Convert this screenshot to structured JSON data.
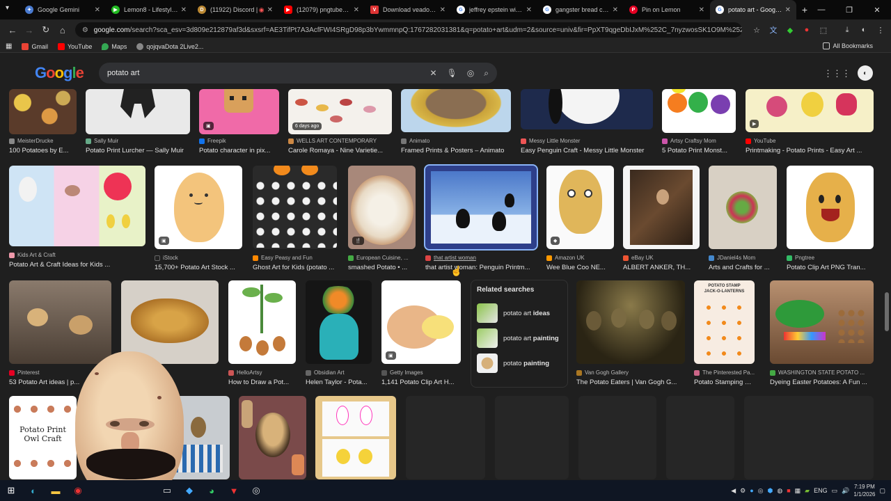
{
  "browser": {
    "tabs": [
      {
        "label": "Google Gemini",
        "color": "#4a7bd0",
        "glyph": "✦"
      },
      {
        "label": "Lemon8 - Lifestyle Co",
        "color": "#e8d34a",
        "glyph": "▶"
      },
      {
        "label": "(11922) Discord |",
        "color": "#5865f2",
        "glyph": "D"
      },
      {
        "label": "(12079) pngtuber - Y",
        "color": "#ff0000",
        "glyph": "▶"
      },
      {
        "label": "Download veadotube",
        "color": "#d33",
        "glyph": "V"
      },
      {
        "label": "jeffrey epstein witho",
        "color": "#4285f4",
        "glyph": "G"
      },
      {
        "label": "gangster bread carto",
        "color": "#4285f4",
        "glyph": "G"
      },
      {
        "label": "Pin on Lemon",
        "color": "#e60023",
        "glyph": "P"
      },
      {
        "label": "potato art - Google S",
        "color": "#4285f4",
        "glyph": "G"
      }
    ],
    "url_domain": "google.com",
    "url_rest": "/search?sca_esv=3d809e212879af3d&sxsrf=AE3TifPt7A3AcfFWI4SRgD98p3bYwmmnpQ:1767282031381&q=potato+art&udm=2&source=univ&fir=PpXT9qgeDbIJxM%252C_7nyzwosSK1O9M%252C_%2538GEkb1..."
  },
  "bookmarks": [
    {
      "label": "Gmail",
      "color": "#ea4335"
    },
    {
      "label": "YouTube",
      "color": "#ff0000"
    },
    {
      "label": "Maps",
      "color": "#34a853"
    },
    {
      "label": "qojqvaDota 2Live2...",
      "color": "#888888"
    }
  ],
  "all_bookmarks": "All Bookmarks",
  "search": {
    "query": "potato art",
    "logo": "Google"
  },
  "row1": [
    {
      "source": "MeisterDrucke",
      "title": "100 Potatoes by E...",
      "src_color": "#888"
    },
    {
      "source": "Sally Muir",
      "title": "Potato Print Lurcher — Sally Muir",
      "src_color": "#6a8"
    },
    {
      "source": "Freepik",
      "title": "Potato character in pix...",
      "src_color": "#1273eb"
    },
    {
      "source": "WELLS ART CONTEMPORARY",
      "title": "Carole Romaya - Nine Varietie...",
      "src_color": "#c84"
    },
    {
      "source": "Animato",
      "title": "Framed Prints & Posters – Animato",
      "src_color": "#777"
    },
    {
      "source": "Messy Little Monster",
      "title": "Easy Penguin Craft - Messy Little Monster",
      "src_color": "#e55"
    },
    {
      "source": "Artsy Craftsy Mom",
      "title": "5 Potato Print Monst...",
      "src_color": "#c5a"
    },
    {
      "source": "YouTube",
      "title": "Printmaking - Potato Prints - Easy Art ...",
      "src_color": "#f00"
    }
  ],
  "row1_badge_days": "6 days ago",
  "row2": [
    {
      "source": "Kids Art & Craft",
      "title": "Potato Art & Craft Ideas for Kids ...",
      "src_color": "#e9a"
    },
    {
      "source": "iStock",
      "title": "15,700+ Potato Art Stock ...",
      "src_color": "#222"
    },
    {
      "source": "Easy Peasy and Fun",
      "title": "Ghost Art for Kids (potato ...",
      "src_color": "#f80"
    },
    {
      "source": "European Cuisine, ...",
      "title": "smashed Potato • ...",
      "src_color": "#4a4"
    },
    {
      "source": "that artist woman",
      "title": "that artist woman: Penguin Printm...",
      "src_color": "#d44"
    },
    {
      "source": "Amazon UK",
      "title": "Wee Blue Coo NE...",
      "src_color": "#f90"
    },
    {
      "source": "eBay UK",
      "title": "ALBERT ANKER, TH...",
      "src_color": "#e53"
    },
    {
      "source": "JDaniel4s Mom",
      "title": "Arts and Crafts for ...",
      "src_color": "#48c"
    },
    {
      "source": "Pngtree",
      "title": "Potato Clip Art PNG Tran...",
      "src_color": "#3b6"
    }
  ],
  "row3": [
    {
      "source": "Pinterest",
      "title": "53 Potato Art ideas | p...",
      "src_color": "#e60023"
    },
    {
      "source": "HelloArtsy",
      "title": "How to Draw a Pot...",
      "src_color": "#c55"
    },
    {
      "source": "Obsidian Art",
      "title": "Helen Taylor - Pota...",
      "src_color": "#666"
    },
    {
      "source": "Getty Images",
      "title": "1,141 Potato Clip Art H...",
      "src_color": "#555"
    },
    {
      "source": "Van Gogh Gallery",
      "title": "The Potato Eaters | Van Gogh G...",
      "src_color": "#a72"
    },
    {
      "source": "The Pinterested Pa...",
      "title": "Potato Stamping – ...",
      "src_color": "#c68"
    },
    {
      "source": "WASHINGTON STATE POTATO ...",
      "title": "Dyeing Easter Potatoes: A Fun ...",
      "src_color": "#4a4"
    }
  ],
  "related": {
    "heading": "Related searches",
    "items": [
      {
        "prefix": "potato art ",
        "bold": "ideas"
      },
      {
        "prefix": "potato art ",
        "bold": "painting"
      },
      {
        "prefix": "potato ",
        "bold": "painting"
      }
    ]
  },
  "row4": {
    "owl_text_1": "Potato Print",
    "owl_text_2": "Owl Craft"
  },
  "taskbar": {
    "lang": "ENG",
    "time": "7:19 PM",
    "date": "1/1/2026"
  },
  "stamp_text": "POTATO STAMP\nJACK-O-LANTERNS"
}
